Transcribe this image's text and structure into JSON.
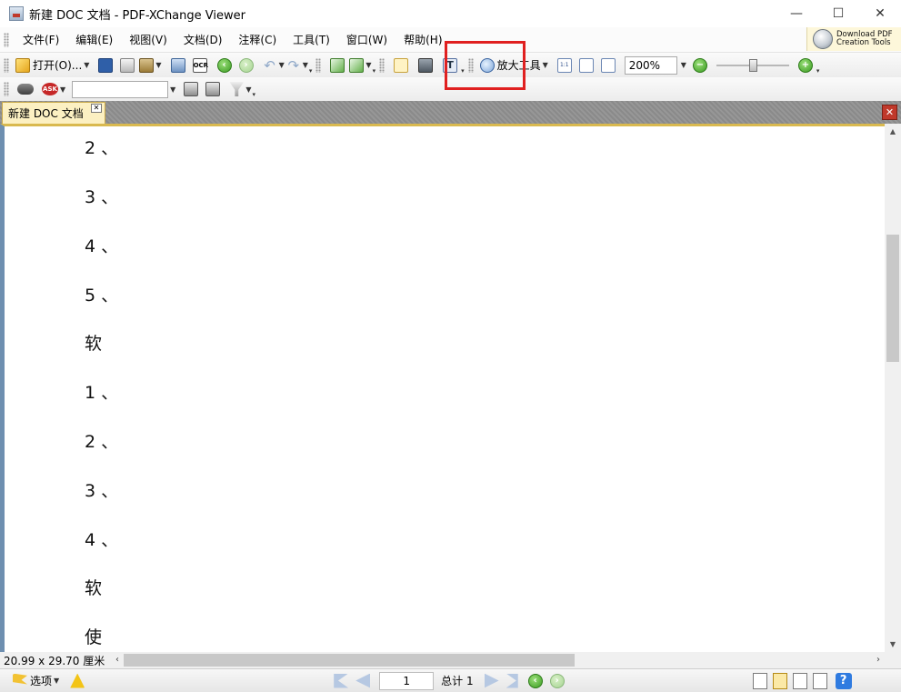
{
  "window": {
    "title": "新建 DOC 文档 - PDF-XChange Viewer",
    "minimize_glyph": "—",
    "maximize_glyph": "☐",
    "close_glyph": "✕"
  },
  "menu": {
    "items": [
      "文件(F)",
      "编辑(E)",
      "视图(V)",
      "文档(D)",
      "注释(C)",
      "工具(T)",
      "窗口(W)",
      "帮助(H)"
    ],
    "download_line1": "Download PDF",
    "download_line2": "Creation Tools"
  },
  "toolbar1": {
    "open_label": "打开(O)...",
    "ocr_label": "OCR",
    "text_select_glyph": "T",
    "zoom_tool_label": "放大工具",
    "actual_size_label": "1:1",
    "zoom_value": "200%",
    "zoom_out_glyph": "−",
    "zoom_in_glyph": "+"
  },
  "toolbar2": {
    "ask_label": "ASK",
    "search_value": ""
  },
  "tabs": {
    "active_label": "新建 DOC 文档",
    "close_glyph": "✕"
  },
  "document": {
    "lines": [
      "2 、",
      "3 、",
      "4 、",
      "5 、",
      "软",
      "1 、",
      "2 、",
      "3 、",
      "4 、",
      "软",
      "使"
    ]
  },
  "status": {
    "page_size": "20.99 x 29.70 厘米",
    "options_label": "选项",
    "current_page": "1",
    "total_pages": "总计 1",
    "help_glyph": "?"
  },
  "colors": {
    "highlight_box": "#e02020",
    "tab_active": "#fcf0c2"
  }
}
